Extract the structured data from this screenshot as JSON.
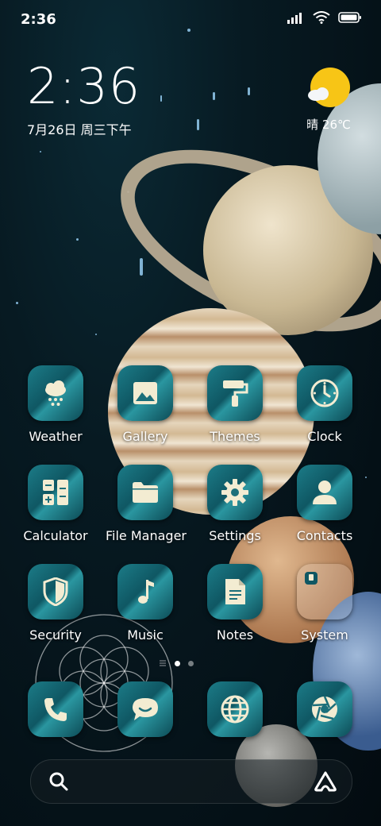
{
  "status_bar": {
    "time": "2:36"
  },
  "clock_widget": {
    "time": "2:36",
    "date": "7月26日 周三下午"
  },
  "weather_widget": {
    "text": "晴 26℃"
  },
  "apps": [
    {
      "label": "Weather",
      "icon": "weather-snow-icon"
    },
    {
      "label": "Gallery",
      "icon": "image-icon"
    },
    {
      "label": "Themes",
      "icon": "paint-roller-icon"
    },
    {
      "label": "Clock",
      "icon": "clock-icon"
    },
    {
      "label": "Calculator",
      "icon": "calculator-icon"
    },
    {
      "label": "File Manager",
      "icon": "folder-icon"
    },
    {
      "label": "Settings",
      "icon": "gear-icon"
    },
    {
      "label": "Contacts",
      "icon": "person-icon"
    },
    {
      "label": "Security",
      "icon": "shield-icon"
    },
    {
      "label": "Music",
      "icon": "music-note-icon"
    },
    {
      "label": "Notes",
      "icon": "document-icon"
    },
    {
      "label": "System",
      "icon": "folder-grid-icon"
    }
  ],
  "dock": [
    {
      "icon": "phone-icon"
    },
    {
      "icon": "message-icon"
    },
    {
      "icon": "globe-icon"
    },
    {
      "icon": "camera-aperture-icon"
    }
  ],
  "colors": {
    "icon_accent": "#1c7c88",
    "icon_glyph": "#f3ecd2"
  }
}
